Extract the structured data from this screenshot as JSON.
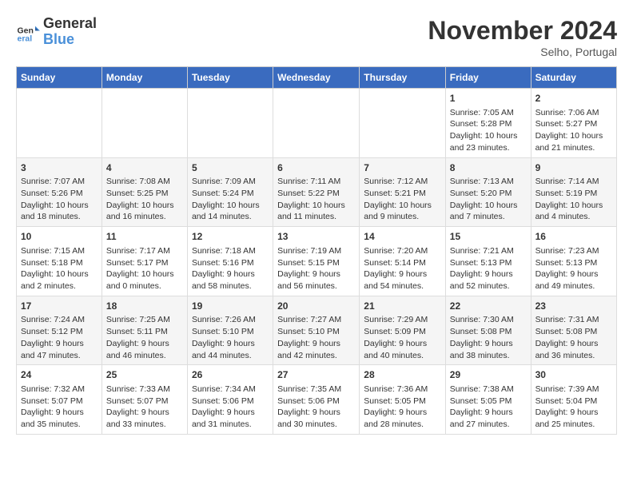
{
  "header": {
    "logo_line1": "General",
    "logo_line2": "Blue",
    "month": "November 2024",
    "location": "Selho, Portugal"
  },
  "days_of_week": [
    "Sunday",
    "Monday",
    "Tuesday",
    "Wednesday",
    "Thursday",
    "Friday",
    "Saturday"
  ],
  "weeks": [
    [
      {
        "day": "",
        "info": ""
      },
      {
        "day": "",
        "info": ""
      },
      {
        "day": "",
        "info": ""
      },
      {
        "day": "",
        "info": ""
      },
      {
        "day": "",
        "info": ""
      },
      {
        "day": "1",
        "info": "Sunrise: 7:05 AM\nSunset: 5:28 PM\nDaylight: 10 hours and 23 minutes."
      },
      {
        "day": "2",
        "info": "Sunrise: 7:06 AM\nSunset: 5:27 PM\nDaylight: 10 hours and 21 minutes."
      }
    ],
    [
      {
        "day": "3",
        "info": "Sunrise: 7:07 AM\nSunset: 5:26 PM\nDaylight: 10 hours and 18 minutes."
      },
      {
        "day": "4",
        "info": "Sunrise: 7:08 AM\nSunset: 5:25 PM\nDaylight: 10 hours and 16 minutes."
      },
      {
        "day": "5",
        "info": "Sunrise: 7:09 AM\nSunset: 5:24 PM\nDaylight: 10 hours and 14 minutes."
      },
      {
        "day": "6",
        "info": "Sunrise: 7:11 AM\nSunset: 5:22 PM\nDaylight: 10 hours and 11 minutes."
      },
      {
        "day": "7",
        "info": "Sunrise: 7:12 AM\nSunset: 5:21 PM\nDaylight: 10 hours and 9 minutes."
      },
      {
        "day": "8",
        "info": "Sunrise: 7:13 AM\nSunset: 5:20 PM\nDaylight: 10 hours and 7 minutes."
      },
      {
        "day": "9",
        "info": "Sunrise: 7:14 AM\nSunset: 5:19 PM\nDaylight: 10 hours and 4 minutes."
      }
    ],
    [
      {
        "day": "10",
        "info": "Sunrise: 7:15 AM\nSunset: 5:18 PM\nDaylight: 10 hours and 2 minutes."
      },
      {
        "day": "11",
        "info": "Sunrise: 7:17 AM\nSunset: 5:17 PM\nDaylight: 10 hours and 0 minutes."
      },
      {
        "day": "12",
        "info": "Sunrise: 7:18 AM\nSunset: 5:16 PM\nDaylight: 9 hours and 58 minutes."
      },
      {
        "day": "13",
        "info": "Sunrise: 7:19 AM\nSunset: 5:15 PM\nDaylight: 9 hours and 56 minutes."
      },
      {
        "day": "14",
        "info": "Sunrise: 7:20 AM\nSunset: 5:14 PM\nDaylight: 9 hours and 54 minutes."
      },
      {
        "day": "15",
        "info": "Sunrise: 7:21 AM\nSunset: 5:13 PM\nDaylight: 9 hours and 52 minutes."
      },
      {
        "day": "16",
        "info": "Sunrise: 7:23 AM\nSunset: 5:13 PM\nDaylight: 9 hours and 49 minutes."
      }
    ],
    [
      {
        "day": "17",
        "info": "Sunrise: 7:24 AM\nSunset: 5:12 PM\nDaylight: 9 hours and 47 minutes."
      },
      {
        "day": "18",
        "info": "Sunrise: 7:25 AM\nSunset: 5:11 PM\nDaylight: 9 hours and 46 minutes."
      },
      {
        "day": "19",
        "info": "Sunrise: 7:26 AM\nSunset: 5:10 PM\nDaylight: 9 hours and 44 minutes."
      },
      {
        "day": "20",
        "info": "Sunrise: 7:27 AM\nSunset: 5:10 PM\nDaylight: 9 hours and 42 minutes."
      },
      {
        "day": "21",
        "info": "Sunrise: 7:29 AM\nSunset: 5:09 PM\nDaylight: 9 hours and 40 minutes."
      },
      {
        "day": "22",
        "info": "Sunrise: 7:30 AM\nSunset: 5:08 PM\nDaylight: 9 hours and 38 minutes."
      },
      {
        "day": "23",
        "info": "Sunrise: 7:31 AM\nSunset: 5:08 PM\nDaylight: 9 hours and 36 minutes."
      }
    ],
    [
      {
        "day": "24",
        "info": "Sunrise: 7:32 AM\nSunset: 5:07 PM\nDaylight: 9 hours and 35 minutes."
      },
      {
        "day": "25",
        "info": "Sunrise: 7:33 AM\nSunset: 5:07 PM\nDaylight: 9 hours and 33 minutes."
      },
      {
        "day": "26",
        "info": "Sunrise: 7:34 AM\nSunset: 5:06 PM\nDaylight: 9 hours and 31 minutes."
      },
      {
        "day": "27",
        "info": "Sunrise: 7:35 AM\nSunset: 5:06 PM\nDaylight: 9 hours and 30 minutes."
      },
      {
        "day": "28",
        "info": "Sunrise: 7:36 AM\nSunset: 5:05 PM\nDaylight: 9 hours and 28 minutes."
      },
      {
        "day": "29",
        "info": "Sunrise: 7:38 AM\nSunset: 5:05 PM\nDaylight: 9 hours and 27 minutes."
      },
      {
        "day": "30",
        "info": "Sunrise: 7:39 AM\nSunset: 5:04 PM\nDaylight: 9 hours and 25 minutes."
      }
    ]
  ]
}
